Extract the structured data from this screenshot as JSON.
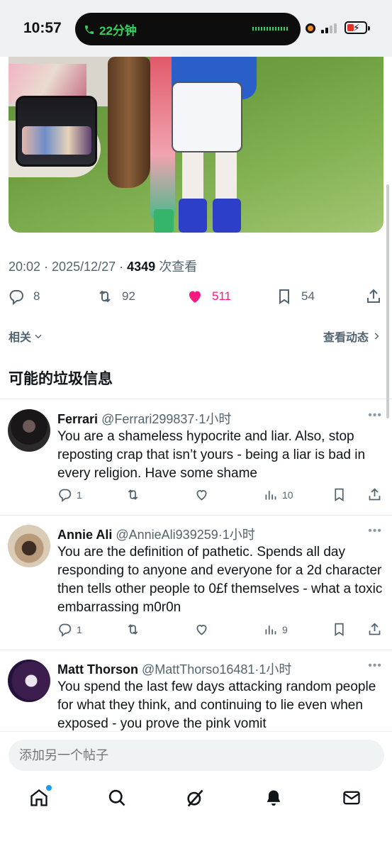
{
  "status_bar": {
    "time": "10:57",
    "call_duration": "22分钟"
  },
  "tweet": {
    "time": "20:02",
    "date": "2025/12/27",
    "views": "4349",
    "views_label": "次查看",
    "replies": "8",
    "retweets": "92",
    "likes": "511",
    "bookmarks": "54",
    "like_color": "#f91880"
  },
  "related": {
    "label": "相关",
    "see_activity": "查看动态"
  },
  "spam_section": {
    "title": "可能的垃圾信息"
  },
  "replies": [
    {
      "name": "Ferrari",
      "handle": "@Ferrari299837",
      "time": "1小时",
      "text": "You are a shameless hypocrite and liar. Also, stop reposting crap that isn’t yours - being a liar is bad in every religion. Have some shame",
      "reply_count": "1",
      "views": "10"
    },
    {
      "name": "Annie Ali",
      "handle": "@AnnieAli939259",
      "time": "1小时",
      "text": "You are the definition of pathetic. Spends all day responding to anyone and everyone for a 2d character then tells other people to 0£f themselves - what a toxic embarrassing m0r0n",
      "reply_count": "1",
      "views": "9"
    },
    {
      "name": "Matt Thorson",
      "handle": "@MattThorso16481",
      "time": "1小时",
      "text": "You spend the last few days attacking random people for what they think, and continuing to lie even when exposed - you prove the pink vomit"
    }
  ],
  "composer": {
    "placeholder": "添加另一个帖子"
  },
  "nav": [
    "home-icon",
    "search-icon",
    "grok-icon",
    "notifications-icon",
    "messages-icon"
  ]
}
